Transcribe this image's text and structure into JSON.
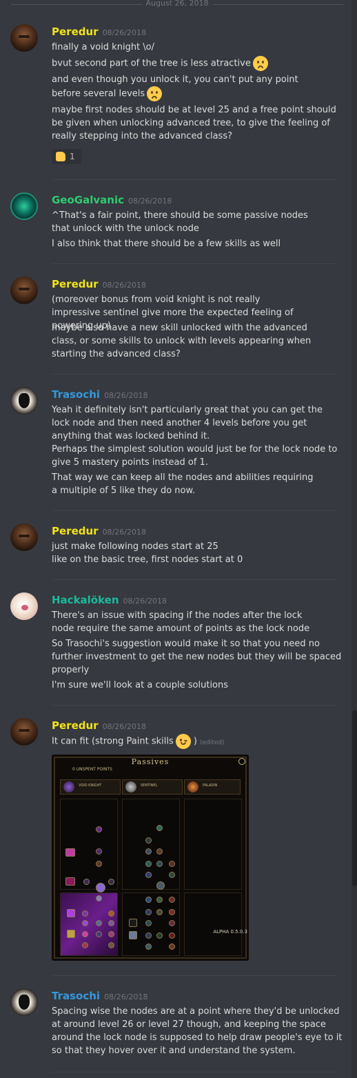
{
  "date_divider": "August 26, 2018",
  "messages": [
    {
      "author": "Peredur",
      "timestamp": "08/26/2018",
      "lines": [
        "finally a void knight \\o/",
        "bvut second part of the tree is less atractive",
        "and even though you unlock it, you can't put any point before several levels",
        "maybe first nodes should be at level 25 and a free point should be given when unlocking advanced tree, to give the feeling of really stepping into  the advanced class?"
      ],
      "reaction": {
        "emoji": "thumbs-up",
        "count": "1"
      }
    },
    {
      "author": "GeoGalvanic",
      "timestamp": "08/26/2018",
      "lines": [
        "^That's a fair point, there should be some passive nodes that unlock with the unlock node",
        "I also think that there should be a few skills as well"
      ]
    },
    {
      "author": "Peredur",
      "timestamp": "08/26/2018",
      "lines": [
        "(moreover bonus from void knight is not really impressive sentinel give more the expected feeling of powering up)",
        "maybe also have a new skill unlocked with the advanced class, or some skills to unlock with levels appearing when starting the advanced class?"
      ]
    },
    {
      "author": "Trasochi",
      "timestamp": "08/26/2018",
      "lines": [
        "Yeah it definitely isn't particularly great that you can get the lock node and then need another 4 levels before you get anything that was locked behind it.",
        "Perhaps the simplest solution would just be for the lock node to give 5 mastery points instead of 1.",
        "That way we can keep all the nodes and abilities requiring a multiple of 5 like they do now."
      ]
    },
    {
      "author": "Peredur",
      "timestamp": "08/26/2018",
      "lines": [
        "just make following nodes start at 25",
        "like on the basic tree, first nodes start at 0"
      ]
    },
    {
      "author": "Hackalöken",
      "timestamp": "08/26/2018",
      "lines": [
        "There's an issue with spacing if the nodes after the lock node require the same amount of points as the lock node",
        "So Trasochi's suggestion would make it so that you need no further investment to get the new nodes but they will be spaced properly",
        "I'm sure we'll look at a couple solutions"
      ]
    },
    {
      "author": "Peredur",
      "timestamp": "08/26/2018",
      "lines": [
        "It can fit (strong Paint skills",
        ")"
      ],
      "edited_label": "(edited)",
      "attachment": {
        "title": "Passives",
        "unspent": "0 UNSPENT POINTS",
        "classes": [
          "VOID KNIGHT",
          "SENTINEL",
          "PALADIN"
        ],
        "version": "ALPHA 0.5.0.3"
      }
    },
    {
      "author": "Trasochi",
      "timestamp": "08/26/2018",
      "lines": [
        "Spacing wise the nodes are at a point where they'd be unlocked at around level 26 or level 27 though, and keeping the space around the lock node is supposed to help draw people's eye to it so that they hover over it and understand the system."
      ]
    }
  ],
  "colors": {
    "background": "#36393f",
    "Peredur": "#f1e31a",
    "GeoGalvanic": "#2ecc71",
    "Trasochi": "#3498db",
    "Hackalöken": "#1abc9c"
  }
}
